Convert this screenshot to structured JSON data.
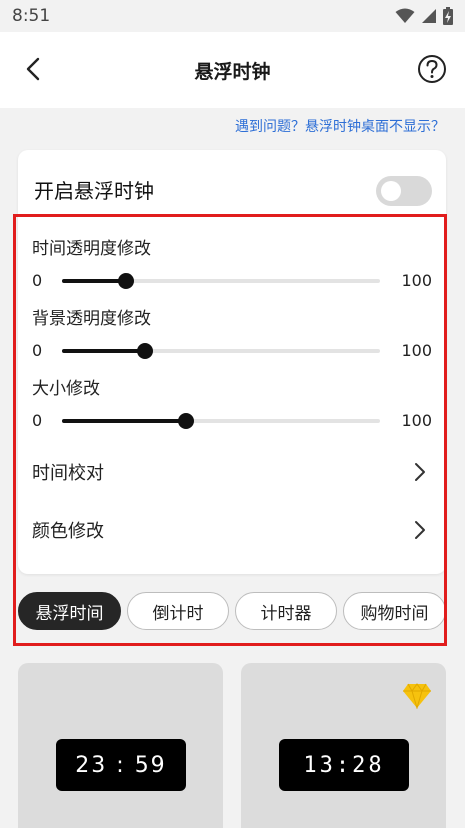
{
  "status": {
    "time": "8:51"
  },
  "header": {
    "title": "悬浮时钟"
  },
  "help_link": "遇到问题？悬浮时钟桌面不显示？",
  "settings": {
    "enable_label": "开启悬浮时钟",
    "enable_on": false,
    "sliders": [
      {
        "label": "时间透明度修改",
        "min": "0",
        "max": "100",
        "value": 20
      },
      {
        "label": "背景透明度修改",
        "min": "0",
        "max": "100",
        "value": 26
      },
      {
        "label": "大小修改",
        "min": "0",
        "max": "100",
        "value": 39
      }
    ],
    "nav": [
      {
        "label": "时间校对"
      },
      {
        "label": "颜色修改"
      }
    ]
  },
  "tabs": [
    {
      "label": "悬浮时间",
      "active": true
    },
    {
      "label": "倒计时",
      "active": false
    },
    {
      "label": "计时器",
      "active": false
    },
    {
      "label": "购物时间",
      "active": false
    }
  ],
  "previews": [
    {
      "time": "23 : 59",
      "premium": false
    },
    {
      "time": "13:28",
      "premium": true
    }
  ],
  "colors": {
    "accent_link": "#2e6fd6",
    "highlight": "#e11d1d",
    "active_tab": "#262626",
    "gem": "#f6c20e"
  }
}
